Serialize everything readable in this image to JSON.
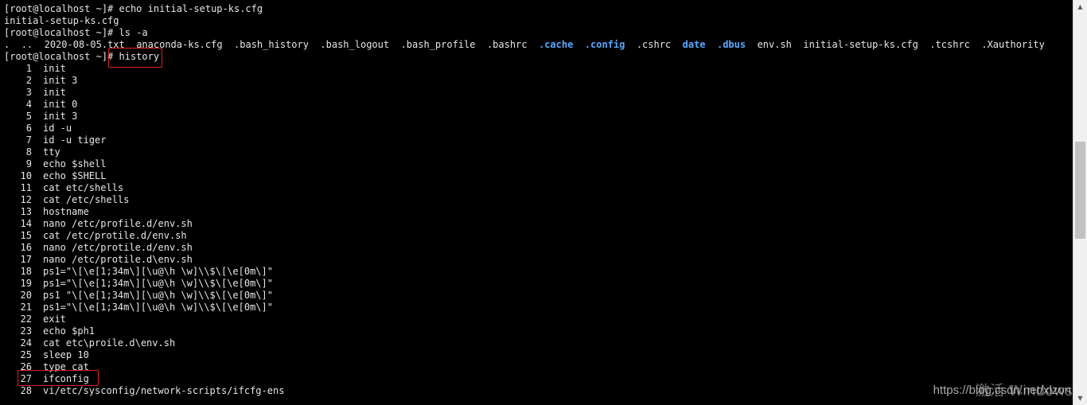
{
  "terminal": {
    "colors": {
      "background": "#000000",
      "text": "#e6e6e6",
      "directory": "#5aa8ff",
      "highlight_box": "#e02020"
    },
    "lines": {
      "cmd1": "[root@localhost ~]# echo initial-setup-ks.cfg",
      "out1": "initial-setup-ks.cfg",
      "cmd2": "[root@localhost ~]# ls -a",
      "prompt3": "[root@localhost ~]# ",
      "cmd3": "history"
    },
    "ls_output": [
      {
        "name": ".",
        "type": "plain"
      },
      {
        "name": "..",
        "type": "plain"
      },
      {
        "name": "2020-08-05.txt",
        "type": "plain"
      },
      {
        "name": "anaconda-ks.cfg",
        "type": "plain"
      },
      {
        "name": ".bash_history",
        "type": "plain"
      },
      {
        "name": ".bash_logout",
        "type": "plain"
      },
      {
        "name": ".bash_profile",
        "type": "plain"
      },
      {
        "name": ".bashrc",
        "type": "plain"
      },
      {
        "name": ".cache",
        "type": "dir"
      },
      {
        "name": ".config",
        "type": "dir"
      },
      {
        "name": ".cshrc",
        "type": "plain"
      },
      {
        "name": "date",
        "type": "dir"
      },
      {
        "name": ".dbus",
        "type": "dir"
      },
      {
        "name": "env.sh",
        "type": "plain"
      },
      {
        "name": "initial-setup-ks.cfg",
        "type": "plain"
      },
      {
        "name": ".tcshrc",
        "type": "plain"
      },
      {
        "name": ".Xauthority",
        "type": "plain"
      }
    ],
    "history": [
      {
        "num": "1",
        "cmd": "init"
      },
      {
        "num": "2",
        "cmd": "init 3"
      },
      {
        "num": "3",
        "cmd": "init"
      },
      {
        "num": "4",
        "cmd": "init 0"
      },
      {
        "num": "5",
        "cmd": "init 3"
      },
      {
        "num": "6",
        "cmd": "id -u"
      },
      {
        "num": "7",
        "cmd": "id -u tiger"
      },
      {
        "num": "8",
        "cmd": "tty"
      },
      {
        "num": "9",
        "cmd": "echo $shell"
      },
      {
        "num": "10",
        "cmd": "echo $SHELL"
      },
      {
        "num": "11",
        "cmd": "cat etc/shells"
      },
      {
        "num": "12",
        "cmd": "cat /etc/shells"
      },
      {
        "num": "13",
        "cmd": "hostname"
      },
      {
        "num": "14",
        "cmd": "nano /etc/profile.d/env.sh"
      },
      {
        "num": "15",
        "cmd": "cat /etc/protile.d/env.sh"
      },
      {
        "num": "16",
        "cmd": "nano /etc/protile.d/env.sh"
      },
      {
        "num": "17",
        "cmd": "nano /etc/protile.d\\env.sh"
      },
      {
        "num": "18",
        "cmd": "ps1=\"\\[\\e[1;34m\\][\\u@\\h \\w]\\\\$\\[\\e[0m\\]\""
      },
      {
        "num": "19",
        "cmd": "ps1=\"\\[\\e[1;34m\\][\\u@\\h \\w]\\\\$\\[\\e[0m\\]\""
      },
      {
        "num": "20",
        "cmd": "ps1 \"\\[\\e[1;34m\\][\\u@\\h \\w]\\\\$\\[\\e[0m\\]\""
      },
      {
        "num": "21",
        "cmd": "ps1=\"\\[\\e[1;34m\\][\\u@\\h \\w]\\\\$\\[\\e[0m\\]\""
      },
      {
        "num": "22",
        "cmd": "exit"
      },
      {
        "num": "23",
        "cmd": "echo $ph1"
      },
      {
        "num": "24",
        "cmd": "cat etc\\proile.d\\env.sh"
      },
      {
        "num": "25",
        "cmd": "sleep 10"
      },
      {
        "num": "26",
        "cmd": "type cat"
      },
      {
        "num": "27",
        "cmd": "ifconfig"
      },
      {
        "num": "28",
        "cmd": "vi/etc/sysconfig/network-scripts/ifcfg-ens"
      }
    ]
  },
  "scrollbar": {
    "up_icon": "chevron-up-icon",
    "down_icon": "chevron-down-icon"
  },
  "watermark": {
    "activate_text": "激活 Windows",
    "url_text": "https://blog.csdn.net/xlzon"
  }
}
